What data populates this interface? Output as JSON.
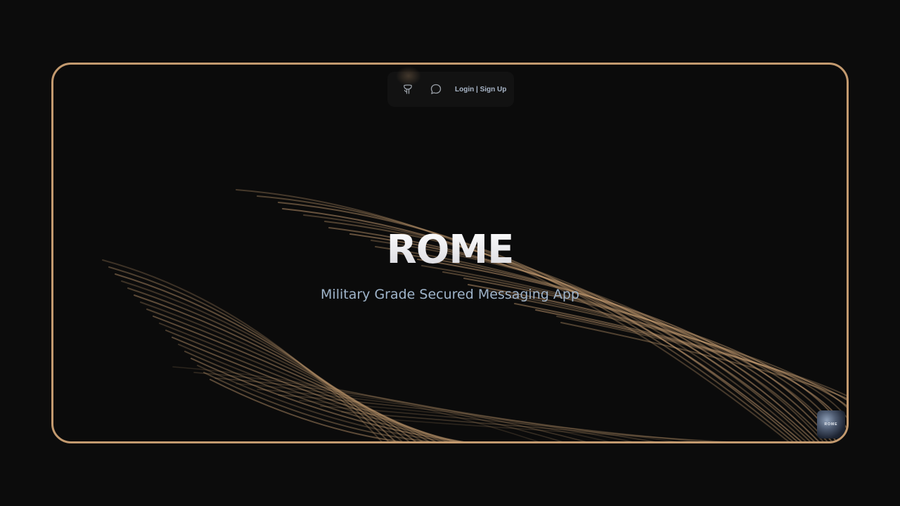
{
  "nav": {
    "github_icon": "github-icon",
    "chat_icon": "chat-bubble-icon",
    "auth_label": "Login | Sign Up"
  },
  "hero": {
    "title": "ROME",
    "subtitle": "Military Grade Secured Messaging App"
  },
  "corner_logo": {
    "text": "ROME"
  },
  "colors": {
    "accent": "#c39a6f",
    "background": "#0c0c0c",
    "subtitle": "#9fb4ca",
    "nav_text": "#a9b6c8"
  }
}
